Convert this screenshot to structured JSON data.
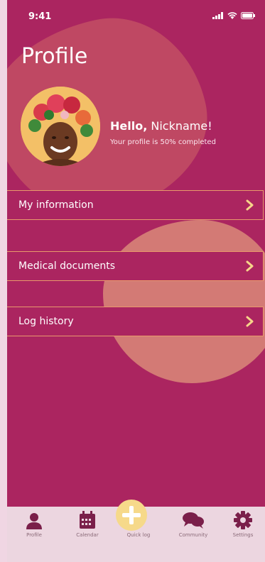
{
  "status": {
    "time": "9:41"
  },
  "header": {
    "title": "Profile"
  },
  "profile": {
    "greeting_bold": "Hello,",
    "nickname": "Nickname!",
    "completion": "Your profile is 50% completed"
  },
  "menu": [
    {
      "label": "My information"
    },
    {
      "label": "Medical documents"
    },
    {
      "label": "Log history"
    }
  ],
  "tabs": [
    {
      "label": "Profile",
      "icon": "person-icon"
    },
    {
      "label": "Calendar",
      "icon": "calendar-icon"
    },
    {
      "label": "Quick log",
      "icon": "plus-icon"
    },
    {
      "label": "Community",
      "icon": "chat-bubbles-icon"
    },
    {
      "label": "Settings",
      "icon": "gear-icon"
    }
  ],
  "colors": {
    "background": "#ab2560",
    "blob_top": "#c04a63",
    "blob_mid": "#d37a75",
    "row_border": "#e89a6c",
    "tabbar": "#ecd6e0",
    "quick_log": "#f6d98a",
    "tab_icon": "#7a1f4a"
  }
}
